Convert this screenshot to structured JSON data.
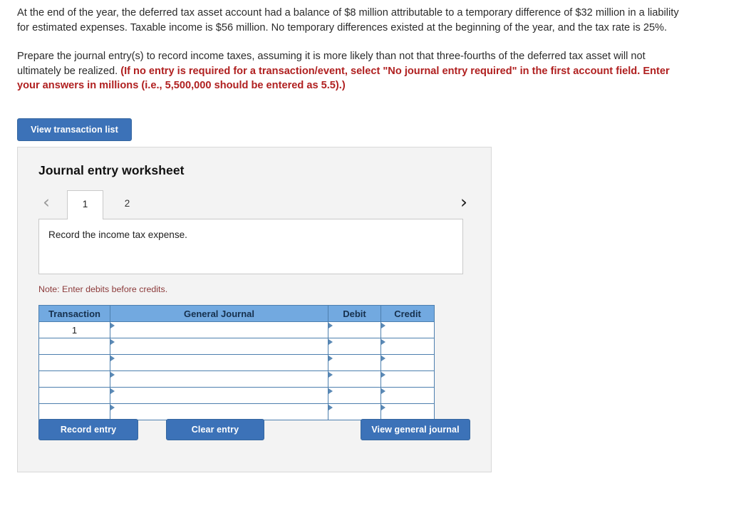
{
  "problem": {
    "paragraph1": "At the end of the year, the deferred tax asset account had a balance of $8 million attributable to a temporary difference of $32 million in a liability for estimated expenses. Taxable income is $56 million. No temporary differences existed at the beginning of the year, and the tax rate is 25%.",
    "paragraph2_plain": "Prepare the journal entry(s) to record income taxes, assuming it is more likely than not that three-fourths of the deferred tax asset will not ultimately be realized. ",
    "paragraph2_emphasis": "(If no entry is required for a transaction/event, select \"No journal entry required\" in the first account field. Enter your answers in millions (i.e., 5,500,000 should be entered as 5.5).)"
  },
  "toolbar": {
    "view_transaction_list_label": "View transaction list"
  },
  "worksheet": {
    "title": "Journal entry worksheet",
    "tabs": [
      {
        "label": "1",
        "active": true
      },
      {
        "label": "2",
        "active": false
      }
    ],
    "prev_icon": "‹",
    "next_icon": "›",
    "description": "Record the income tax expense.",
    "note": "Note: Enter debits before credits."
  },
  "journal": {
    "columns": [
      "Transaction",
      "General Journal",
      "Debit",
      "Credit"
    ],
    "rows": [
      {
        "transaction": "1",
        "general_journal": "",
        "debit": "",
        "credit": ""
      },
      {
        "transaction": "",
        "general_journal": "",
        "debit": "",
        "credit": ""
      },
      {
        "transaction": "",
        "general_journal": "",
        "debit": "",
        "credit": ""
      },
      {
        "transaction": "",
        "general_journal": "",
        "debit": "",
        "credit": ""
      },
      {
        "transaction": "",
        "general_journal": "",
        "debit": "",
        "credit": ""
      },
      {
        "transaction": "",
        "general_journal": "",
        "debit": "",
        "credit": ""
      }
    ]
  },
  "actions": {
    "record_entry_label": "Record entry",
    "clear_entry_label": "Clear entry",
    "view_general_journal_label": "View general journal"
  },
  "colors": {
    "button_blue": "#3c72b8",
    "table_header_blue": "#72a9e0",
    "emphasis_red": "#b02020",
    "note_red": "#8c3b3b",
    "panel_grey": "#f3f3f3"
  }
}
